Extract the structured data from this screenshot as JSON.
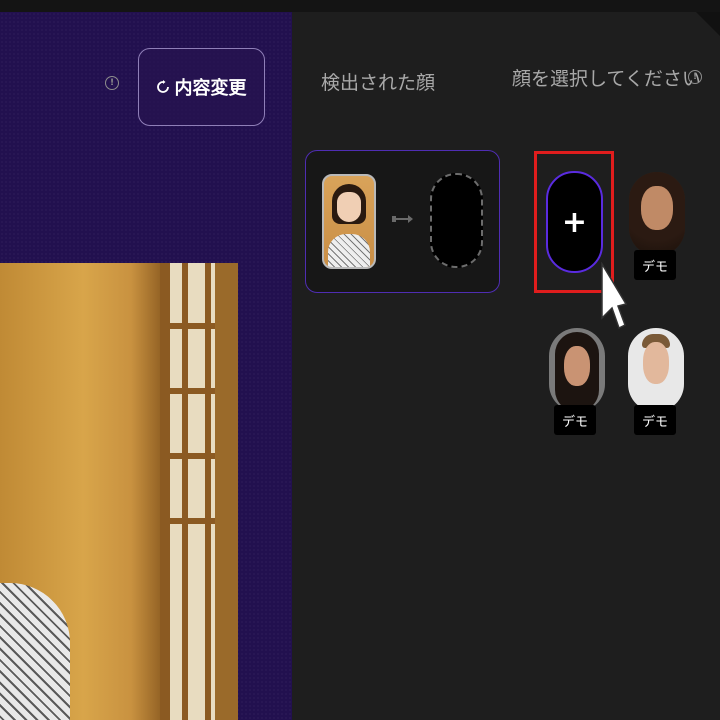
{
  "toolbar": {
    "change_label": "内容変更",
    "info_symbol": "!"
  },
  "detected": {
    "title": "検出された顔"
  },
  "select": {
    "title": "顔を選択してください",
    "add_symbol": "+",
    "demo_label": "デモ"
  },
  "icons": [
    "info-icon",
    "refresh-icon",
    "arrow-right-icon",
    "plus-icon",
    "mouse-cursor-icon"
  ],
  "colors": {
    "left_panel": "#22104f",
    "right_panel": "#1e1e1e",
    "accent_purple": "#5a2be0",
    "highlight_red": "#e01d1d"
  }
}
